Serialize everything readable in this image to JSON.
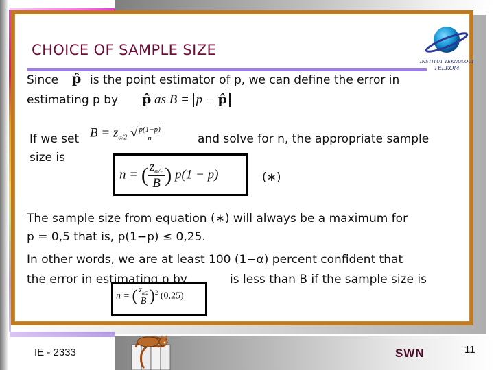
{
  "slide": {
    "title": "CHOICE  OF SAMPLE SIZE",
    "logo": {
      "icon": "globe-logo-icon",
      "line1": "INSTITUT TEKNOLOGI",
      "line2": "TELKOM"
    },
    "paragraph1": {
      "line1_a": "Since",
      "line1_b": "is the point estimator of p, we can define the error in",
      "line2_a": "estimating p by",
      "formula": {
        "phat": "p̂",
        "as": "as",
        "lhs": "B =",
        "abs_content": "p −"
      }
    },
    "paragraph2": {
      "line1_a": "If we set",
      "line1_b": "and solve for n, the appropriate sample",
      "line2": "size is",
      "formula_B": {
        "lhs": "B = z",
        "sub": "α/2",
        "num": "p(1−p)",
        "den": "n"
      },
      "formula_n": {
        "lhs": "n =",
        "num": "z",
        "sub": "α/2",
        "den": "B",
        "rhs": "p(1 − p)"
      },
      "equation_label": "(∗)"
    },
    "paragraph3": {
      "line1": "The sample size from equation (∗) will always be a maximum for",
      "line2": "p = 0,5 that is, p(1−p) ≤ 0,25."
    },
    "paragraph4": {
      "line1": "In other words, we are at least 100 (1−α) percent confident that",
      "line2_a": "the error in estimating p by",
      "line2_b": "is less than B if the sample size is",
      "formula_n2": {
        "lhs": "n =",
        "num": "z",
        "sub": "α/2",
        "den": "B",
        "exp": "2",
        "rhs": "(0,25)"
      }
    }
  },
  "footer": {
    "course_code": "IE - 2333",
    "author": "SWN",
    "page_number": "11",
    "clipart": "cat-on-fence-icon"
  },
  "colors": {
    "title": "#6e0d35",
    "frame": "#c27a20",
    "title_bar": "#9b7ee0",
    "author": "#4a0a28"
  }
}
